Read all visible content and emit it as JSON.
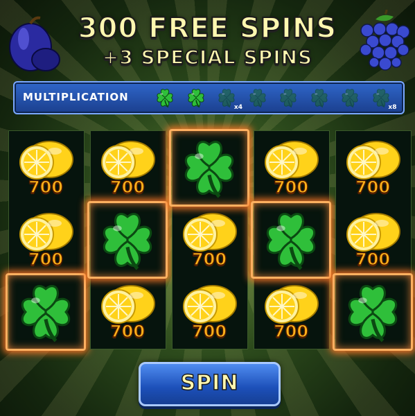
{
  "banner": {
    "line1": "300 FREE SPINS",
    "line2": "+3 SPECIAL SPINS"
  },
  "multiplication": {
    "label": "MULTIPLICATION",
    "slots": [
      {
        "active": true,
        "tag": ""
      },
      {
        "active": true,
        "tag": ""
      },
      {
        "active": false,
        "tag": "x4"
      },
      {
        "active": false,
        "tag": ""
      },
      {
        "active": false,
        "tag": ""
      },
      {
        "active": false,
        "tag": ""
      },
      {
        "active": false,
        "tag": ""
      },
      {
        "active": false,
        "tag": "x8"
      }
    ]
  },
  "reels": [
    [
      {
        "symbol": "lemon",
        "value": "700"
      },
      {
        "symbol": "lemon",
        "value": "700"
      },
      {
        "symbol": "clover",
        "value": ""
      }
    ],
    [
      {
        "symbol": "lemon",
        "value": "700"
      },
      {
        "symbol": "clover",
        "value": ""
      },
      {
        "symbol": "lemon",
        "value": "700"
      }
    ],
    [
      {
        "symbol": "clover",
        "value": ""
      },
      {
        "symbol": "lemon",
        "value": "700"
      },
      {
        "symbol": "lemon",
        "value": "700"
      }
    ],
    [
      {
        "symbol": "lemon",
        "value": "700"
      },
      {
        "symbol": "clover",
        "value": ""
      },
      {
        "symbol": "lemon",
        "value": "700"
      }
    ],
    [
      {
        "symbol": "lemon",
        "value": "700"
      },
      {
        "symbol": "lemon",
        "value": "700"
      },
      {
        "symbol": "clover",
        "value": ""
      }
    ]
  ],
  "spin_button": {
    "label": "SPIN"
  },
  "colors": {
    "clover": "#2fbf3a",
    "lemon": "#ffd21a",
    "accent_blue": "#2f66c9",
    "glow": "#ff8a30"
  }
}
